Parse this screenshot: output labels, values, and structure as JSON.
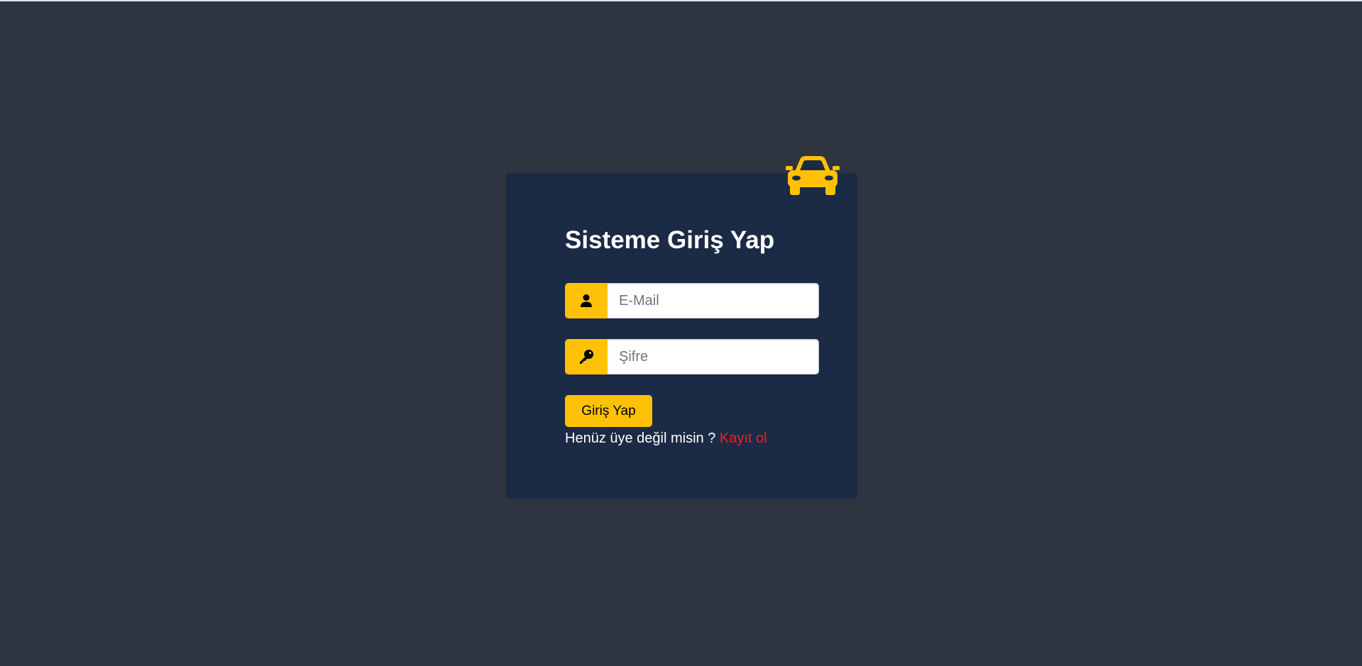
{
  "login": {
    "title": "Sisteme Giriş Yap",
    "email": {
      "placeholder": "E-Mail",
      "value": "",
      "icon": "user-icon"
    },
    "password": {
      "placeholder": "Şifre",
      "value": "",
      "icon": "key-icon"
    },
    "submit_label": "Giriş Yap",
    "register_prompt": "Henüz üye değil misin ?",
    "register_link": "Kayıt ol",
    "brand_icon": "car-icon"
  },
  "colors": {
    "page_background": "#2e3440",
    "card_background": "#1b2a45",
    "accent": "#ffc107",
    "link": "#ff1a1a",
    "text": "#ffffff"
  }
}
